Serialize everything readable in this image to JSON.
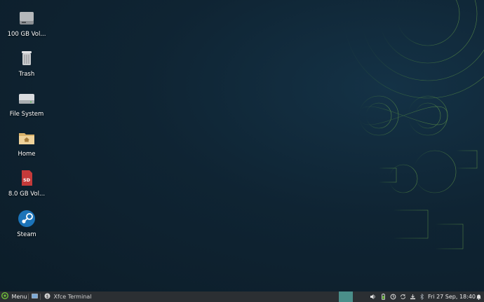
{
  "desktop": {
    "icons": [
      {
        "label": "100 GB Vol...",
        "icon": "hard-drive-icon"
      },
      {
        "label": "Trash",
        "icon": "trash-icon"
      },
      {
        "label": "File System",
        "icon": "file-system-drive-icon"
      },
      {
        "label": "Home",
        "icon": "home-folder-icon"
      },
      {
        "label": "8.0 GB Vol...",
        "icon": "sd-card-icon"
      },
      {
        "label": "Steam",
        "icon": "steam-icon"
      }
    ]
  },
  "taskbar": {
    "menu_label": "Menu",
    "task_label": "Xfce Terminal",
    "clock": "Fri 27 Sep, 18:40",
    "tray_icons": [
      "volume-icon",
      "battery-icon",
      "update-icon",
      "sync-icon",
      "network-icon",
      "bluetooth-icon",
      "notification-bell-icon"
    ]
  },
  "colors": {
    "wallpaper": "#0f2230",
    "accent_green": "#6fbf3a",
    "panel": "#2b2f33",
    "workspace_active": "#4a8e8a"
  }
}
